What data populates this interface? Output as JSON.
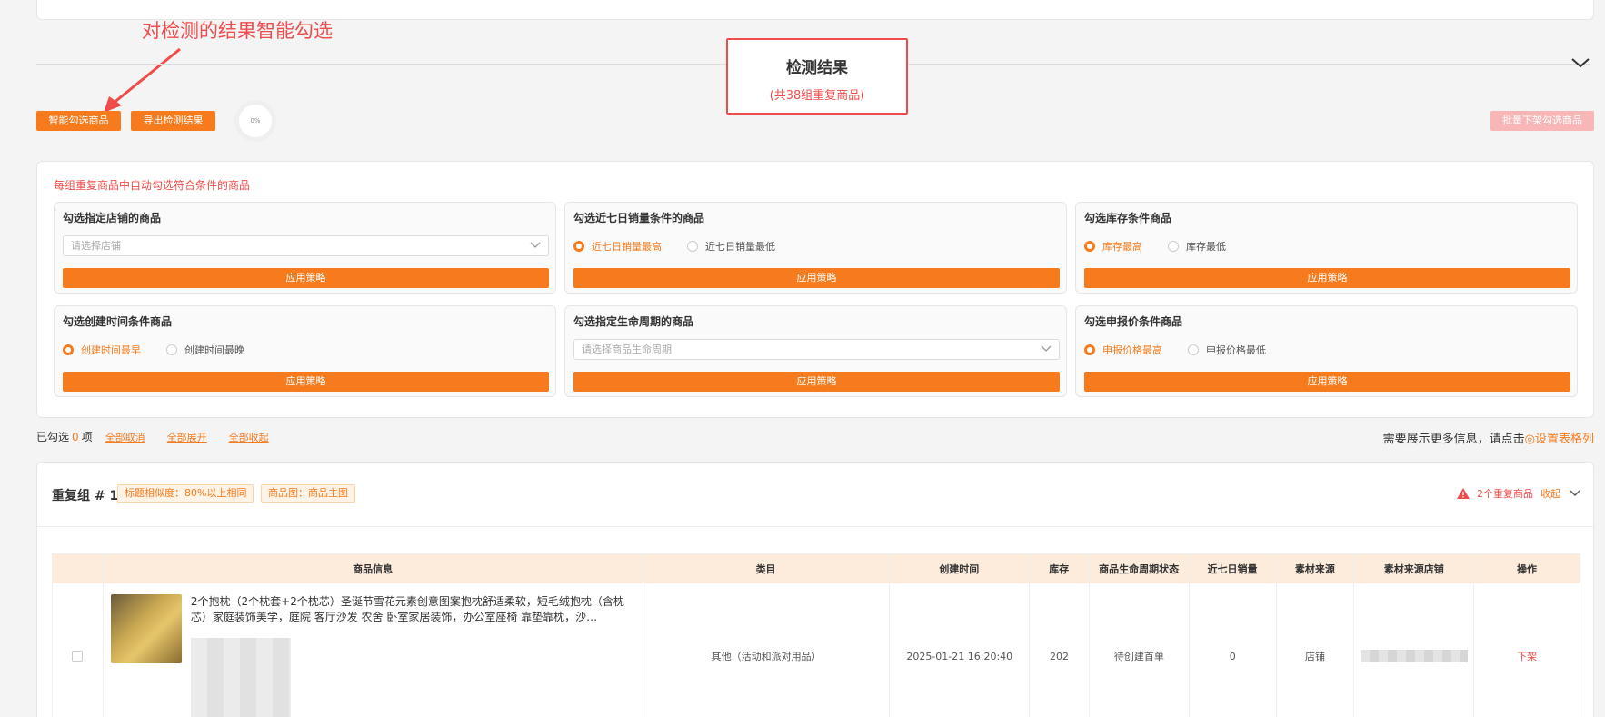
{
  "annotation": "对检测的结果智能勾选",
  "result": {
    "title": "检测结果",
    "subtitle": "(共38组重复商品)"
  },
  "toolbar": {
    "smart_select": "智能勾选商品",
    "export": "导出检测结果",
    "progress": "0%",
    "batch_down": "批量下架勾选商品"
  },
  "rules": {
    "hint": "每组重复商品中自动勾选符合条件的商品",
    "apply_label": "应用策略",
    "shop": {
      "title": "勾选指定店铺的商品",
      "placeholder": "请选择店铺"
    },
    "sales": {
      "title": "勾选近七日销量条件的商品",
      "opt1": "近七日销量最高",
      "opt2": "近七日销量最低"
    },
    "stock": {
      "title": "勾选库存条件商品",
      "opt1": "库存最高",
      "opt2": "库存最低"
    },
    "created": {
      "title": "勾选创建时间条件商品",
      "opt1": "创建时间最早",
      "opt2": "创建时间最晚"
    },
    "lifecycle": {
      "title": "勾选指定生命周期的商品",
      "placeholder": "请选择商品生命周期"
    },
    "price": {
      "title": "勾选申报价条件商品",
      "opt1": "申报价格最高",
      "opt2": "申报价格最低"
    }
  },
  "selection": {
    "prefix": "已勾选",
    "count": "0",
    "suffix": "项",
    "cancel_all": "全部取消",
    "expand_all": "全部展开",
    "collapse_all": "全部收起",
    "more_info": "需要展示更多信息，请点击",
    "settings_link": "◎设置表格列"
  },
  "group": {
    "title": "重复组 # 1",
    "tag1": "标题相似度：80%以上相同",
    "tag2": "商品图：商品主图",
    "dup_count": "2个重复商品",
    "collapse": "收起"
  },
  "table": {
    "headers": [
      "商品信息",
      "类目",
      "创建时间",
      "库存",
      "商品生命周期状态",
      "近七日销量",
      "素材来源",
      "素材来源店铺",
      "操作"
    ],
    "rows": [
      {
        "title": "2个抱枕（2个枕套+2个枕芯）圣诞节雪花元素创意图案抱枕舒适柔软，短毛绒抱枕（含枕芯）家庭装饰美学，庭院 客厅沙发 农舍 卧室家居装饰，办公室座椅 靠垫靠枕，沙…",
        "category": "其他（活动和派对用品）",
        "created": "2025-01-21 16:20:40",
        "stock": "202",
        "lifecycle": "待创建首单",
        "sales7": "0",
        "source": "店铺",
        "action": "下架"
      }
    ]
  },
  "colors": {
    "accent": "#f77b1c",
    "danger": "#f24b4b",
    "header_bg": "#fdebdc"
  }
}
